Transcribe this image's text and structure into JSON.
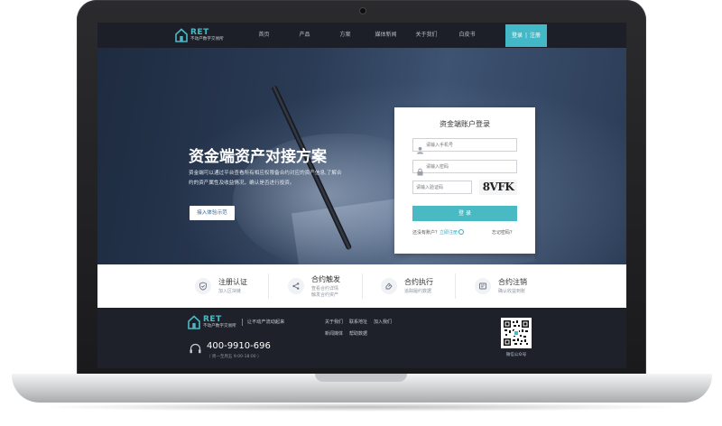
{
  "nav": {
    "logo_title": "RET",
    "logo_sub": "不动产数字交易所",
    "items": [
      "首页",
      "产品",
      "方案",
      "媒体新闻",
      "关于我们",
      "白皮书"
    ],
    "login_label": "登录",
    "login_sep": "|",
    "register_label": "注册",
    "accent_color": "#43b8c6"
  },
  "hero": {
    "title": "资金端资产对接方案",
    "desc": "资金端可以通过平台查看所有相应权限备合约对应的资产信息,了解合约的资产属性及收益情况，确认是否进行投资。",
    "button": "接入体验示范"
  },
  "login": {
    "title": "资金端账户登录",
    "phone_placeholder": "请输入手机号",
    "password_placeholder": "请输入密码",
    "code_placeholder": "请输入验证码",
    "captcha": "8VFK",
    "submit": "登 录",
    "no_account": "还没有账户？",
    "register_link": "立即注册",
    "forgot": "忘记密码？"
  },
  "features": [
    {
      "title": "注册认证",
      "sub": [
        "加入区块链"
      ],
      "icon": "shield-icon"
    },
    {
      "title": "合约触发",
      "sub": [
        "查看合约详情",
        "触发合约资产"
      ],
      "icon": "share-icon"
    },
    {
      "title": "合约执行",
      "sub": [
        "追踪履约数据"
      ],
      "icon": "execute-icon"
    },
    {
      "title": "合约注销",
      "sub": [
        "确认收益到账"
      ],
      "icon": "card-icon"
    }
  ],
  "footer": {
    "logo_title": "RET",
    "logo_sub": "不动产数字交易所",
    "slogan": "让不动产流动起来",
    "phone": "400-9910-696",
    "hours": "（ 周一至周五 9:00-18:00 ）",
    "links": [
      "关于我们",
      "联系地址",
      "加入我们",
      "新闻媒体",
      "帮助数据"
    ],
    "qr_label": "微信公众号"
  }
}
